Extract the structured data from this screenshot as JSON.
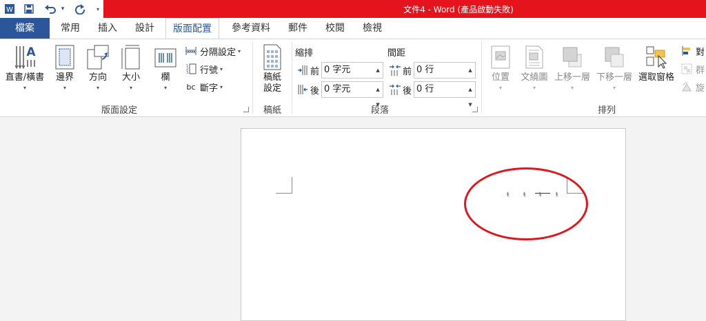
{
  "window": {
    "title": "文件4 - Word (產品啟動失敗)"
  },
  "qat": {
    "icons": [
      "word-app-icon",
      "save-icon",
      "undo-icon",
      "redo-icon",
      "customize-icon"
    ],
    "dropdown": "▾"
  },
  "tabs": [
    {
      "label": "檔案"
    },
    {
      "label": "常用"
    },
    {
      "label": "插入"
    },
    {
      "label": "設計"
    },
    {
      "label": "版面配置"
    },
    {
      "label": "參考資料"
    },
    {
      "label": "郵件"
    },
    {
      "label": "校閱"
    },
    {
      "label": "檢視"
    }
  ],
  "ribbon": {
    "page_setup": {
      "text_direction": "直書/橫書",
      "margins": "邊界",
      "orientation": "方向",
      "size": "大小",
      "columns": "欄",
      "breaks": "分隔設定",
      "line_numbers": "行號",
      "hyphenation": "斷字",
      "group_label": "版面設定"
    },
    "draft": {
      "button_line1": "稿紙",
      "button_line2": "設定",
      "group_label": "稿紙"
    },
    "paragraph": {
      "indent_header": "縮排",
      "spacing_header": "間距",
      "before_label": "前",
      "after_label": "後",
      "indent_left_value": "0 字元",
      "indent_right_value": "0 字元",
      "spacing_before_value": "0 行",
      "spacing_after_value": "0 行",
      "group_label": "段落"
    },
    "arrange": {
      "position": "位置",
      "wrap_text": "文繞圖",
      "bring_forward": "上移一層",
      "send_backward": "下移一層",
      "selection_pane": "選取窗格",
      "align": "對",
      "group": "群",
      "rotate": "旋",
      "group_label": "排列"
    }
  },
  "document": {
    "marks": [
      "ŧ",
      "ŧ",
      "ŧ",
      "ŧ"
    ]
  },
  "colors": {
    "title_bar": "#e5141c",
    "file_tab": "#2b579a",
    "annotation": "#e0161e"
  }
}
